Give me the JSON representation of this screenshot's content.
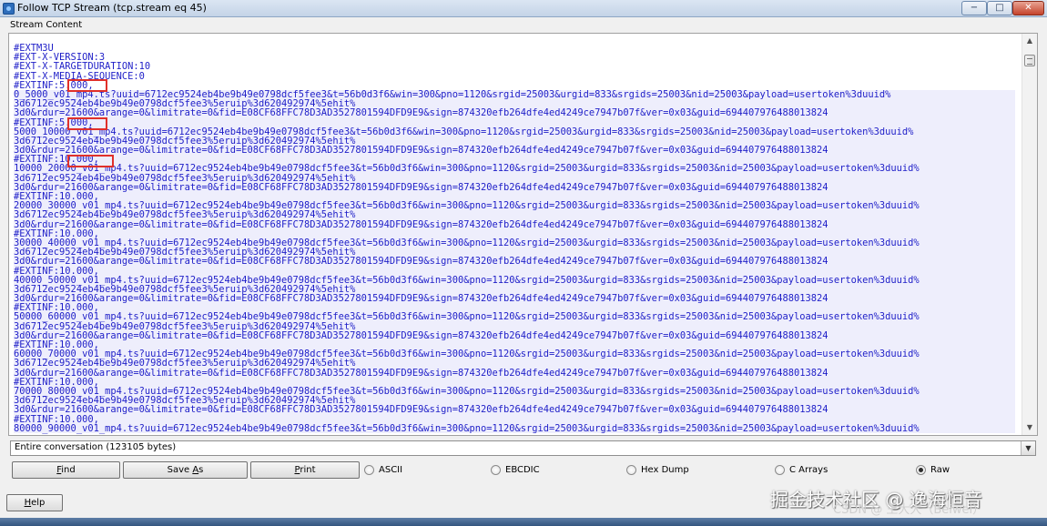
{
  "window": {
    "title": "Follow TCP Stream (tcp.stream eq 45)",
    "controls": {
      "minimize": "−",
      "maximize": "□",
      "close": "✕"
    }
  },
  "group_label": "Stream Content",
  "stream_lines": [
    "#EXTM3U",
    "#EXT-X-VERSION:3",
    "#EXT-X-TARGETDURATION:10",
    "#EXT-X-MEDIA-SEQUENCE:0",
    "#EXTINF:5.000,",
    "0_5000_v01_mp4.ts?uuid=6712ec9524eb4be9b49e0798dcf5fee3&t=56b0d3f6&win=300&pno=1120&srgid=25003&urgid=833&srgids=25003&nid=25003&payload=usertoken%3duuid%",
    "3d6712ec9524eb4be9b49e0798dcf5fee3%5eruip%3d620492974%5ehit%",
    "3d0&rdur=21600&arange=0&limitrate=0&fid=E08CF68FFC78D3AD3527801594DFD9E9&sign=874320efb264dfe4ed4249ce7947b07f&ver=0x03&guid=694407976488013824",
    "#EXTINF:5.000,",
    "5000_10000_v01_mp4.ts?uuid=6712ec9524eb4be9b49e0798dcf5fee3&t=56b0d3f6&win=300&pno=1120&srgid=25003&urgid=833&srgids=25003&nid=25003&payload=usertoken%3duuid%",
    "3d6712ec9524eb4be9b49e0798dcf5fee3%5eruip%3d620492974%5ehit%",
    "3d0&rdur=21600&arange=0&limitrate=0&fid=E08CF68FFC78D3AD3527801594DFD9E9&sign=874320efb264dfe4ed4249ce7947b07f&ver=0x03&guid=694407976488013824",
    "#EXTINF:10.000,",
    "10000_20000_v01_mp4.ts?uuid=6712ec9524eb4be9b49e0798dcf5fee3&t=56b0d3f6&win=300&pno=1120&srgid=25003&urgid=833&srgids=25003&nid=25003&payload=usertoken%3duuid%",
    "3d6712ec9524eb4be9b49e0798dcf5fee3%5eruip%3d620492974%5ehit%",
    "3d0&rdur=21600&arange=0&limitrate=0&fid=E08CF68FFC78D3AD3527801594DFD9E9&sign=874320efb264dfe4ed4249ce7947b07f&ver=0x03&guid=694407976488013824",
    "#EXTINF:10.000,",
    "20000_30000_v01_mp4.ts?uuid=6712ec9524eb4be9b49e0798dcf5fee3&t=56b0d3f6&win=300&pno=1120&srgid=25003&urgid=833&srgids=25003&nid=25003&payload=usertoken%3duuid%",
    "3d6712ec9524eb4be9b49e0798dcf5fee3%5eruip%3d620492974%5ehit%",
    "3d0&rdur=21600&arange=0&limitrate=0&fid=E08CF68FFC78D3AD3527801594DFD9E9&sign=874320efb264dfe4ed4249ce7947b07f&ver=0x03&guid=694407976488013824",
    "#EXTINF:10.000,",
    "30000_40000_v01_mp4.ts?uuid=6712ec9524eb4be9b49e0798dcf5fee3&t=56b0d3f6&win=300&pno=1120&srgid=25003&urgid=833&srgids=25003&nid=25003&payload=usertoken%3duuid%",
    "3d6712ec9524eb4be9b49e0798dcf5fee3%5eruip%3d620492974%5ehit%",
    "3d0&rdur=21600&arange=0&limitrate=0&fid=E08CF68FFC78D3AD3527801594DFD9E9&sign=874320efb264dfe4ed4249ce7947b07f&ver=0x03&guid=694407976488013824",
    "#EXTINF:10.000,",
    "40000_50000_v01_mp4.ts?uuid=6712ec9524eb4be9b49e0798dcf5fee3&t=56b0d3f6&win=300&pno=1120&srgid=25003&urgid=833&srgids=25003&nid=25003&payload=usertoken%3duuid%",
    "3d6712ec9524eb4be9b49e0798dcf5fee3%5eruip%3d620492974%5ehit%",
    "3d0&rdur=21600&arange=0&limitrate=0&fid=E08CF68FFC78D3AD3527801594DFD9E9&sign=874320efb264dfe4ed4249ce7947b07f&ver=0x03&guid=694407976488013824",
    "#EXTINF:10.000,",
    "50000_60000_v01_mp4.ts?uuid=6712ec9524eb4be9b49e0798dcf5fee3&t=56b0d3f6&win=300&pno=1120&srgid=25003&urgid=833&srgids=25003&nid=25003&payload=usertoken%3duuid%",
    "3d6712ec9524eb4be9b49e0798dcf5fee3%5eruip%3d620492974%5ehit%",
    "3d0&rdur=21600&arange=0&limitrate=0&fid=E08CF68FFC78D3AD3527801594DFD9E9&sign=874320efb264dfe4ed4249ce7947b07f&ver=0x03&guid=694407976488013824",
    "#EXTINF:10.000,",
    "60000_70000_v01_mp4.ts?uuid=6712ec9524eb4be9b49e0798dcf5fee3&t=56b0d3f6&win=300&pno=1120&srgid=25003&urgid=833&srgids=25003&nid=25003&payload=usertoken%3duuid%",
    "3d6712ec9524eb4be9b49e0798dcf5fee3%5eruip%3d620492974%5ehit%",
    "3d0&rdur=21600&arange=0&limitrate=0&fid=E08CF68FFC78D3AD3527801594DFD9E9&sign=874320efb264dfe4ed4249ce7947b07f&ver=0x03&guid=694407976488013824",
    "#EXTINF:10.000,",
    "70000_80000_v01_mp4.ts?uuid=6712ec9524eb4be9b49e0798dcf5fee3&t=56b0d3f6&win=300&pno=1120&srgid=25003&urgid=833&srgids=25003&nid=25003&payload=usertoken%3duuid%",
    "3d6712ec9524eb4be9b49e0798dcf5fee3%5eruip%3d620492974%5ehit%",
    "3d0&rdur=21600&arange=0&limitrate=0&fid=E08CF68FFC78D3AD3527801594DFD9E9&sign=874320efb264dfe4ed4249ce7947b07f&ver=0x03&guid=694407976488013824",
    "#EXTINF:10.000,",
    "80000_90000_v01_mp4.ts?uuid=6712ec9524eb4be9b49e0798dcf5fee3&t=56b0d3f6&win=300&pno=1120&srgid=25003&urgid=833&srgids=25003&nid=25003&payload=usertoken%3duuid%"
  ],
  "highlighted_values": [
    "5.000",
    "5.000",
    "10.000"
  ],
  "conversation": {
    "value": "Entire conversation (123105 bytes)",
    "arrow": "▼"
  },
  "buttons": {
    "find": {
      "accel": "F",
      "rest": "ind"
    },
    "save_as": {
      "pre": "Save ",
      "accel": "A",
      "rest": "s"
    },
    "print": {
      "accel": "P",
      "rest": "rint"
    },
    "help": {
      "accel": "H",
      "rest": "elp"
    }
  },
  "formats": [
    {
      "label": "ASCII",
      "selected": false
    },
    {
      "label": "EBCDIC",
      "selected": false
    },
    {
      "label": "Hex Dump",
      "selected": false
    },
    {
      "label": "C Arrays",
      "selected": false
    },
    {
      "label": "Raw",
      "selected": true
    }
  ],
  "scrollbar": {
    "up": "▲",
    "down": "▼"
  },
  "watermark": {
    "main": "掘金技术社区 @ 逸海恒音",
    "sub": "CSDN @ 王大大（Beiwei）"
  },
  "colors": {
    "stream_text": "#1e1ec8",
    "annotation": "#e0302a"
  }
}
